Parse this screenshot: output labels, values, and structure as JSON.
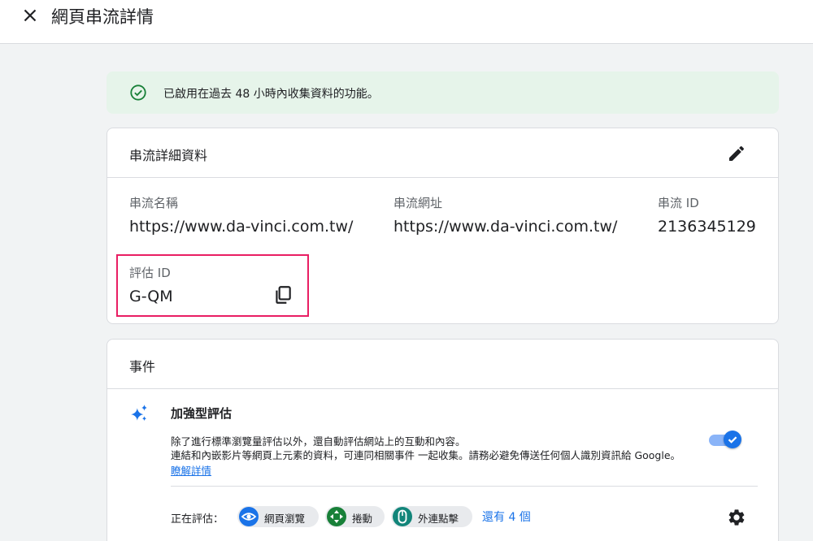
{
  "header": {
    "title": "網頁串流詳情"
  },
  "banner": {
    "text": "已啟用在過去 48 小時內收集資料的功能。"
  },
  "stream_details": {
    "title": "串流詳細資料",
    "stream_name": {
      "label": "串流名稱",
      "value": "https://www.da-vinci.com.tw/"
    },
    "stream_url": {
      "label": "串流網址",
      "value": "https://www.da-vinci.com.tw/"
    },
    "stream_id": {
      "label": "串流 ID",
      "value": "2136345129"
    },
    "measurement_id": {
      "label": "評估 ID",
      "value": "G-QM"
    }
  },
  "events": {
    "title": "事件",
    "enhanced": {
      "title": "加強型評估",
      "desc_line1": "除了進行標準瀏覽量評估以外，還自動評估網站上的互動和內容。",
      "desc_line2": "連結和內嵌影片等網頁上元素的資料，可連同相關事件 一起收集。請務必避免傳送任何個人識別資訊給 Google。",
      "learn_more": "瞭解詳情",
      "enabled": true
    },
    "measuring_label": "正在評估：",
    "chips": [
      {
        "label": "網頁瀏覽",
        "icon": "eye-icon",
        "color": "#1a73e8"
      },
      {
        "label": "捲動",
        "icon": "scroll-arrows-icon",
        "color": "#188038"
      },
      {
        "label": "外連點擊",
        "icon": "mouse-icon",
        "color": "#12857a"
      }
    ],
    "more_link": "還有 4 個"
  }
}
